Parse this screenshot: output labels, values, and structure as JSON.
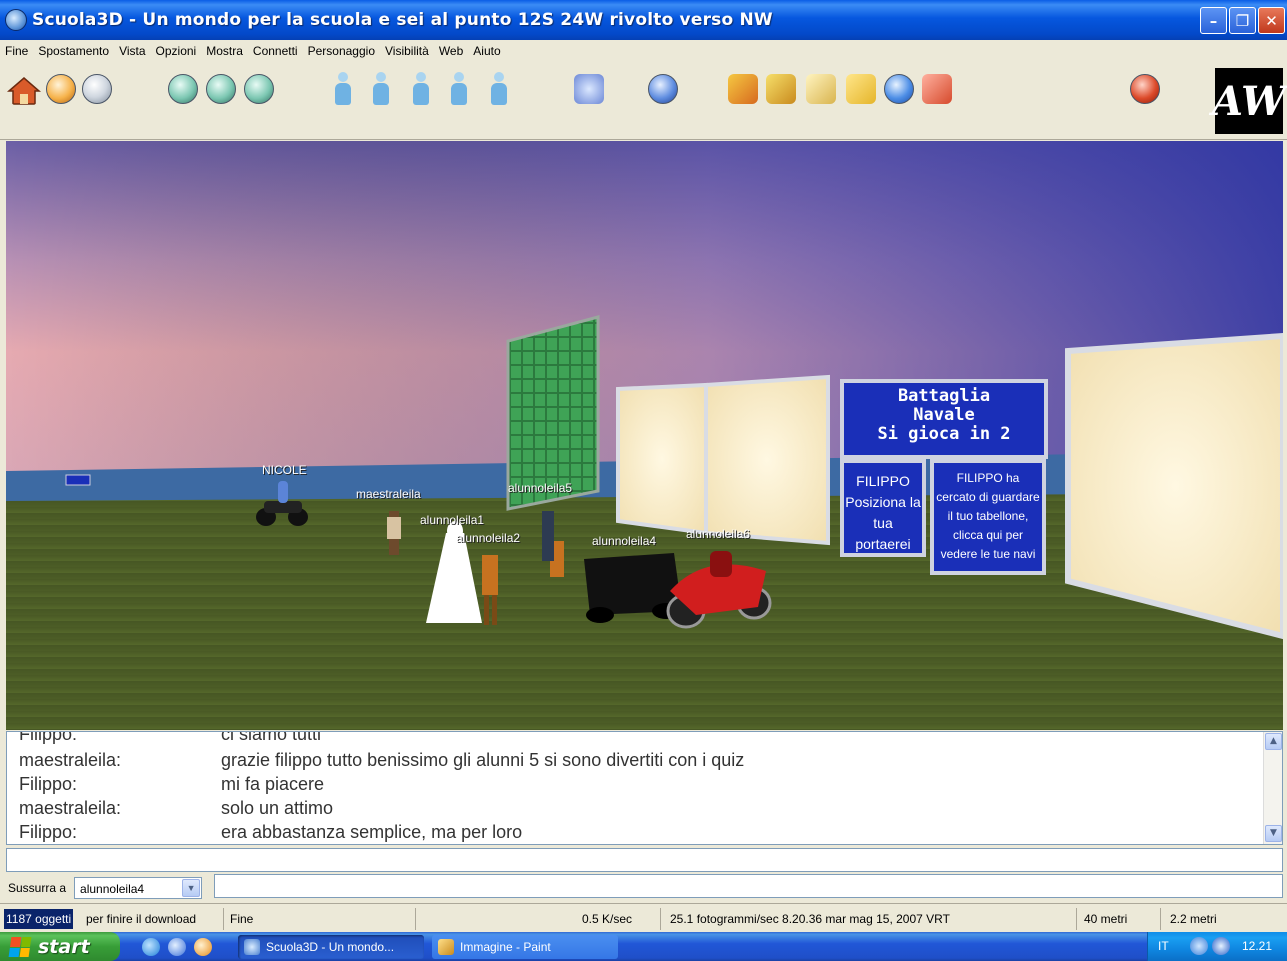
{
  "window": {
    "title": "Scuola3D - Un mondo per la scuola e sei al punto 12S 24W rivolto verso NW",
    "controls": [
      "minimize",
      "maximize",
      "close"
    ]
  },
  "menu": [
    "Fine",
    "Spostamento",
    "Vista",
    "Opzioni",
    "Mostra",
    "Connetti",
    "Personaggio",
    "Visibilità",
    "Web",
    "Aiuto"
  ],
  "toolbar": {
    "logo_text": "AW",
    "icons": [
      "home-icon",
      "back-icon",
      "forward-icon",
      "view-1-icon",
      "view-2-icon",
      "view-3-icon",
      "avatar-1-icon",
      "avatar-2-icon",
      "avatar-3-icon",
      "avatar-4-icon",
      "avatar-5-icon",
      "chat-icon",
      "globe-icon",
      "telegram-icon",
      "mail-icon",
      "notes-icon",
      "folder-icon",
      "refresh-icon",
      "gift-icon",
      "stop-icon"
    ]
  },
  "scene": {
    "avatar_labels": [
      "NICOLE",
      "maestraleila",
      "alunnoleila5",
      "alunnoleila1",
      "alunnoleila2",
      "alunnoleila4",
      "alunnoleila6"
    ],
    "sign_title": [
      "Battaglia",
      "Navale",
      "Si gioca in 2"
    ],
    "sign_left": [
      "FILIPPO",
      "Posiziona la",
      "tua portaerei"
    ],
    "sign_right": [
      "FILIPPO ha",
      "cercato di guardare",
      "il tuo tabellone,",
      "clicca qui per",
      "vedere le tue navi"
    ]
  },
  "chat": {
    "lines": [
      {
        "name": "Filippo:",
        "msg": "ci siamo tutti"
      },
      {
        "name": "maestraleila:",
        "msg": "grazie filippo tutto benissimo gli alunni 5 si sono divertiti con i quiz"
      },
      {
        "name": "Filippo:",
        "msg": "mi fa piacere"
      },
      {
        "name": "maestraleila:",
        "msg": "solo un attimo"
      },
      {
        "name": "Filippo:",
        "msg": "era abbastanza semplice, ma per loro"
      }
    ]
  },
  "whisper": {
    "label": "Sussurra a",
    "selected": "alunnoleila4"
  },
  "status": {
    "objects": "1187 oggetti",
    "download": "per finire il download",
    "state": "Fine",
    "speed": "0.5 K/sec",
    "fps_time": "25.1 fotogrammi/sec 8.20.36 mar mag 15, 2007 VRT",
    "distance1": "40 metri",
    "distance2": "2.2 metri"
  },
  "taskbar": {
    "start": "start",
    "tasks": [
      "Scuola3D - Un mondo...",
      "Immagine - Paint"
    ],
    "lang": "IT",
    "clock": "12.21"
  },
  "colors": {
    "titlebar": "#0657df",
    "sign_blue": "#1a2fb8",
    "grass": "#4a5a24",
    "sky_top": "#4a47a6",
    "sea": "#3a6fa8"
  }
}
